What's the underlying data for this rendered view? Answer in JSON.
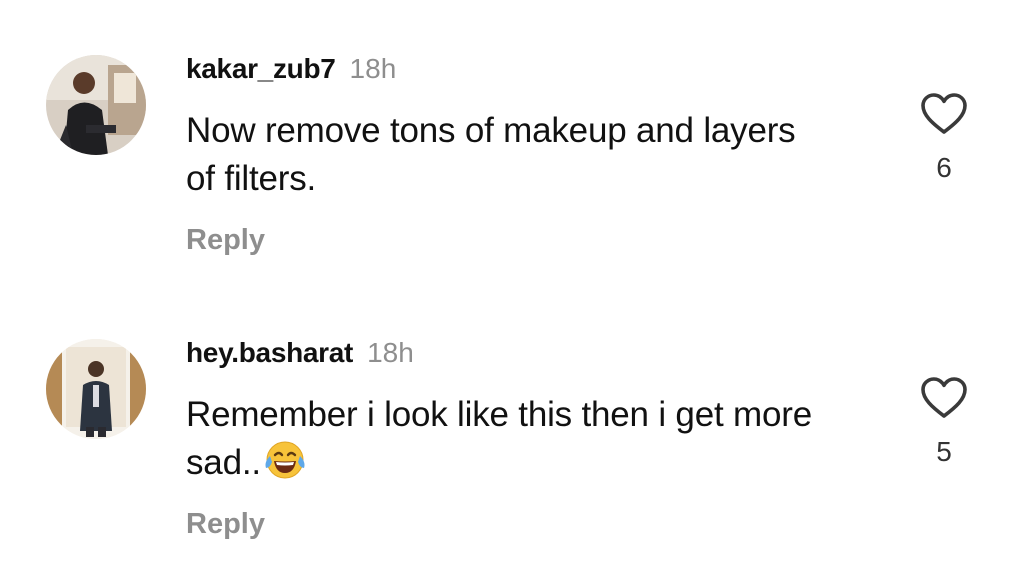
{
  "comments": [
    {
      "username": "kakar_zub7",
      "time": "18h",
      "text": "Now remove tons of makeup and layers of filters.",
      "emoji": "",
      "reply_label": "Reply",
      "likes": "6"
    },
    {
      "username": "hey.basharat",
      "time": "18h",
      "text": "Remember i look like this then i get more sad..",
      "emoji": "face-with-tears-of-joy",
      "reply_label": "Reply",
      "likes": "5"
    }
  ],
  "icons": {
    "like": "heart-outline-icon"
  },
  "colors": {
    "text": "#111111",
    "muted": "#8e8e8e",
    "background": "#ffffff"
  }
}
